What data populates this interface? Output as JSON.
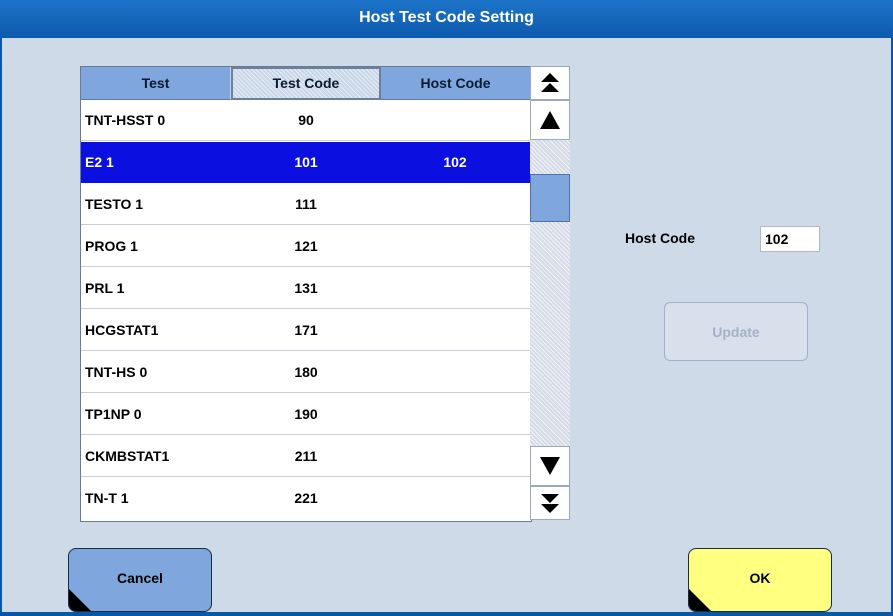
{
  "window": {
    "title": "Host Test Code Setting"
  },
  "table": {
    "headers": [
      "Test",
      "Test Code",
      "Host Code"
    ],
    "rows": [
      {
        "test": "TNT-HSST 0",
        "test_code": "90",
        "host_code": ""
      },
      {
        "test": "E2 1",
        "test_code": "101",
        "host_code": "102"
      },
      {
        "test": "TESTO 1",
        "test_code": "111",
        "host_code": ""
      },
      {
        "test": "PROG 1",
        "test_code": "121",
        "host_code": ""
      },
      {
        "test": "PRL 1",
        "test_code": "131",
        "host_code": ""
      },
      {
        "test": "HCGSTAT1",
        "test_code": "171",
        "host_code": ""
      },
      {
        "test": "TNT-HS 0",
        "test_code": "180",
        "host_code": ""
      },
      {
        "test": "TP1NP 0",
        "test_code": "190",
        "host_code": ""
      },
      {
        "test": "CKMBSTAT1",
        "test_code": "211",
        "host_code": ""
      },
      {
        "test": "TN-T 1",
        "test_code": "221",
        "host_code": ""
      }
    ],
    "selected_row": 1
  },
  "scrollbar": {
    "icons": [
      "scroll-top-icon",
      "scroll-up-icon",
      "scroll-down-icon",
      "scroll-bottom-icon"
    ]
  },
  "host_code": {
    "label": "Host Code",
    "value": "102"
  },
  "buttons": {
    "update": "Update",
    "cancel": "Cancel",
    "ok": "OK"
  },
  "colors": {
    "title_bar": "#0d5aac",
    "header": "#7fa7dd",
    "selection": "#0b10e0",
    "cancel": "#7fa7dd",
    "ok": "#ffff80"
  }
}
